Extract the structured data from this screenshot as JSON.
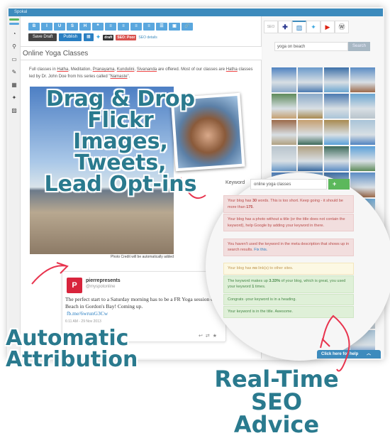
{
  "app": {
    "title": "Spokal"
  },
  "sidebar": {
    "icons": [
      "dashboard-icon",
      "search-icon",
      "monitor-icon",
      "edit-icon",
      "calendar-icon",
      "twitter-icon",
      "image-icon"
    ]
  },
  "toolbar": {
    "format_buttons": [
      "B",
      "I",
      "U",
      "S",
      "H",
      "❝",
      "≡",
      "≡",
      "≡",
      "≡",
      "☰",
      "▣",
      "🔗"
    ],
    "save_draft": "Save Draft",
    "publish": "Publish",
    "status_badge": "draft",
    "seo_badge": "SEO: Poor",
    "seo_details": "SEO details"
  },
  "post": {
    "title": "Online Yoga Classes",
    "body_parts": [
      "Full classes in ",
      "Hatha",
      ", Meditation, ",
      "Pranayama",
      ", ",
      "Kundulini",
      ", ",
      "Sivananda",
      " are offered. Most of our classes are ",
      "Hatha",
      " classes led by Dr. John Doe from his series called \"",
      "Namaste",
      "\"."
    ],
    "photo_credit": "Photo Credit will be automatically added"
  },
  "tweet": {
    "name": "pierrepresents",
    "handle": "@myspotonline",
    "text": "The perfect start to a Saturday morning has to be a FR Yoga session on the Beach in Gordon's Bay! Coming up.",
    "link": "fb.me/6wrunG3Cw",
    "time": "6:11 AM - 29 Nov 2013"
  },
  "right_panel": {
    "tabs": [
      "SEO",
      "plus-icon",
      "image-icon",
      "twitter-icon",
      "video-icon",
      "wordpress-icon"
    ],
    "search_value": "yoga on beach",
    "search_button": "Search"
  },
  "seo": {
    "keyword_label": "Keyword",
    "keyword_value": "online yoga classes",
    "add_button": "+",
    "messages": [
      {
        "type": "bad",
        "parts": [
          "Your blog has ",
          "30",
          " words. This is too short. Keep going - it should be more than ",
          "175",
          "."
        ]
      },
      {
        "type": "bad",
        "parts": [
          "Your blog has a photo without a title (or the title does not contain the keyword), help Google by adding your keyword in there."
        ]
      },
      {
        "type": "bad",
        "parts": [
          "You haven't used the keyword in the meta description that shows up in search results. ",
          "Fix this."
        ]
      },
      {
        "type": "warn",
        "parts": [
          "Your blog has ",
          "no",
          " link(s) to other sites."
        ]
      },
      {
        "type": "good",
        "parts": [
          "The keyword makes up ",
          "3.33%",
          " of your blog, which is great, you used your keyword ",
          "1",
          " times."
        ]
      },
      {
        "type": "good",
        "parts": [
          "Congrats -your keyword is in a heading."
        ]
      },
      {
        "type": "good",
        "parts": [
          "Your keyword is in the title. Awesome."
        ]
      }
    ],
    "help_button": "Click here for help"
  },
  "callouts": {
    "drag_drop": [
      "Drag & Drop",
      "Flickr Images,",
      "Tweets,",
      "Lead Opt-ins"
    ],
    "attribution": [
      "Automatic",
      "Attribution"
    ],
    "seo": [
      "Real-Time SEO",
      "Advice"
    ]
  },
  "colors": {
    "brand": "#3d8bbd",
    "callout": "#2a7a8e",
    "arrow": "#e8344e"
  }
}
